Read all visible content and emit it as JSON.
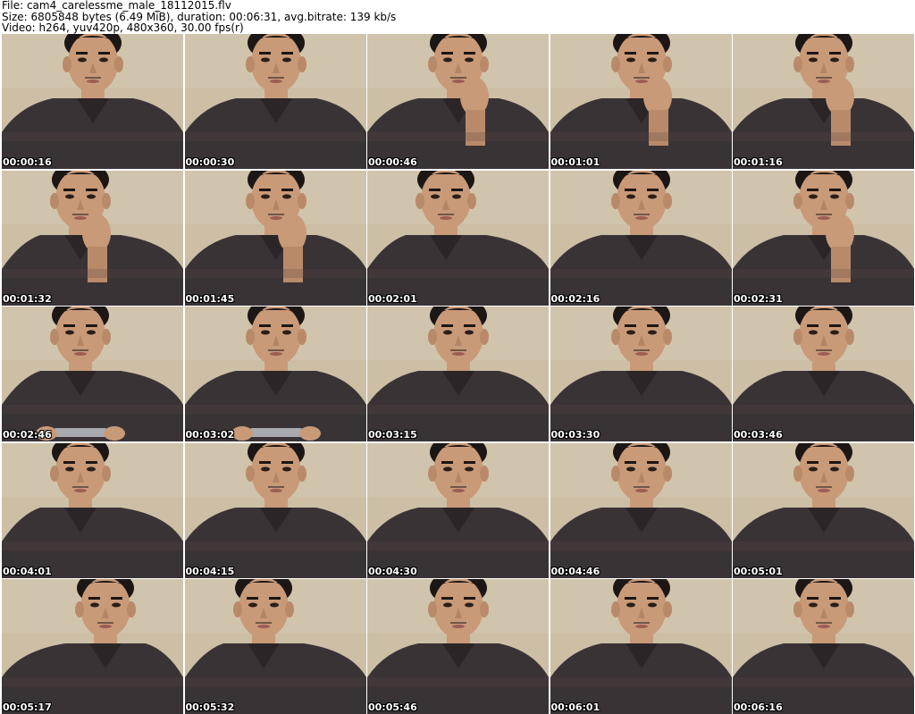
{
  "header": {
    "file_line": "File: cam4_carelessme_male_18112015.flv",
    "size_line": "Size: 6805848 bytes (6.49 MiB), duration: 00:06:31, avg.bitrate: 139 kb/s",
    "video_line": "Video: h264, yuv420p, 480x360, 30.00 fps(r)"
  },
  "colors": {
    "wall": "#cdbfa6",
    "skin": "#c99a78",
    "hair": "#1c1614",
    "hoodie": "#3a3336",
    "desk": "#5a4744"
  },
  "thumbnails": [
    {
      "time": "00:00:16",
      "pose": "center",
      "hand": false,
      "phone": false
    },
    {
      "time": "00:00:30",
      "pose": "center",
      "hand": false,
      "phone": false
    },
    {
      "time": "00:00:46",
      "pose": "center",
      "hand": true,
      "phone": false
    },
    {
      "time": "00:01:01",
      "pose": "center",
      "hand": true,
      "phone": false
    },
    {
      "time": "00:01:16",
      "pose": "center",
      "hand": true,
      "phone": false
    },
    {
      "time": "00:01:32",
      "pose": "left",
      "hand": true,
      "phone": false
    },
    {
      "time": "00:01:45",
      "pose": "center",
      "hand": true,
      "phone": false
    },
    {
      "time": "00:02:01",
      "pose": "left",
      "hand": false,
      "phone": false
    },
    {
      "time": "00:02:16",
      "pose": "center",
      "hand": false,
      "phone": false
    },
    {
      "time": "00:02:31",
      "pose": "center",
      "hand": true,
      "phone": false
    },
    {
      "time": "00:02:46",
      "pose": "left",
      "hand": false,
      "phone": true
    },
    {
      "time": "00:03:02",
      "pose": "center",
      "hand": false,
      "phone": true
    },
    {
      "time": "00:03:15",
      "pose": "center",
      "hand": false,
      "phone": false
    },
    {
      "time": "00:03:30",
      "pose": "center",
      "hand": false,
      "phone": false
    },
    {
      "time": "00:03:46",
      "pose": "center",
      "hand": false,
      "phone": false
    },
    {
      "time": "00:04:01",
      "pose": "left",
      "hand": false,
      "phone": false
    },
    {
      "time": "00:04:15",
      "pose": "center",
      "hand": false,
      "phone": false
    },
    {
      "time": "00:04:30",
      "pose": "center",
      "hand": false,
      "phone": false
    },
    {
      "time": "00:04:46",
      "pose": "center",
      "hand": false,
      "phone": false
    },
    {
      "time": "00:05:01",
      "pose": "center",
      "hand": false,
      "phone": false
    },
    {
      "time": "00:05:17",
      "pose": "right",
      "hand": false,
      "phone": false
    },
    {
      "time": "00:05:32",
      "pose": "left",
      "hand": false,
      "phone": false
    },
    {
      "time": "00:05:46",
      "pose": "center",
      "hand": false,
      "phone": false
    },
    {
      "time": "00:06:01",
      "pose": "center",
      "hand": false,
      "phone": false
    },
    {
      "time": "00:06:16",
      "pose": "center",
      "hand": false,
      "phone": false
    }
  ]
}
